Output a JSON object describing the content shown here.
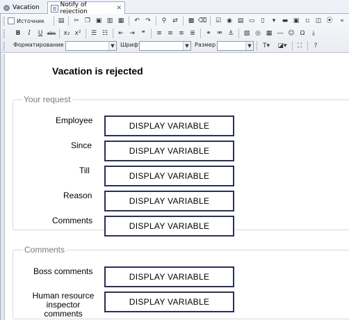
{
  "tabs": [
    {
      "label": "Vacation",
      "icon": "vacation-process-icon",
      "active": false
    },
    {
      "label": "Notify of rejection",
      "icon": "form-document-icon",
      "active": true,
      "closable": true
    }
  ],
  "toolbar": {
    "source_label": "Источник",
    "format_label": "Форматирование",
    "format_value": "",
    "font_label": "Шрифт",
    "font_value": "",
    "size_label": "Размер",
    "size_value": ""
  },
  "form": {
    "title": "Vacation is rejected",
    "request_section": {
      "legend": "Your request",
      "fields": [
        {
          "label": "Employee",
          "value": "DISPLAY VARIABLE"
        },
        {
          "label": "Since",
          "value": "DISPLAY VARIABLE"
        },
        {
          "label": "Till",
          "value": "DISPLAY VARIABLE"
        },
        {
          "label": "Reason",
          "value": "DISPLAY VARIABLE"
        },
        {
          "label": "Comments",
          "value": "DISPLAY VARIABLE"
        }
      ]
    },
    "comments_section": {
      "legend": "Comments",
      "fields": [
        {
          "label": "Boss comments",
          "value": "DISPLAY VARIABLE"
        },
        {
          "label_lines": [
            "Human resource",
            "inspector",
            "comments"
          ],
          "value": "DISPLAY VARIABLE"
        }
      ]
    }
  }
}
